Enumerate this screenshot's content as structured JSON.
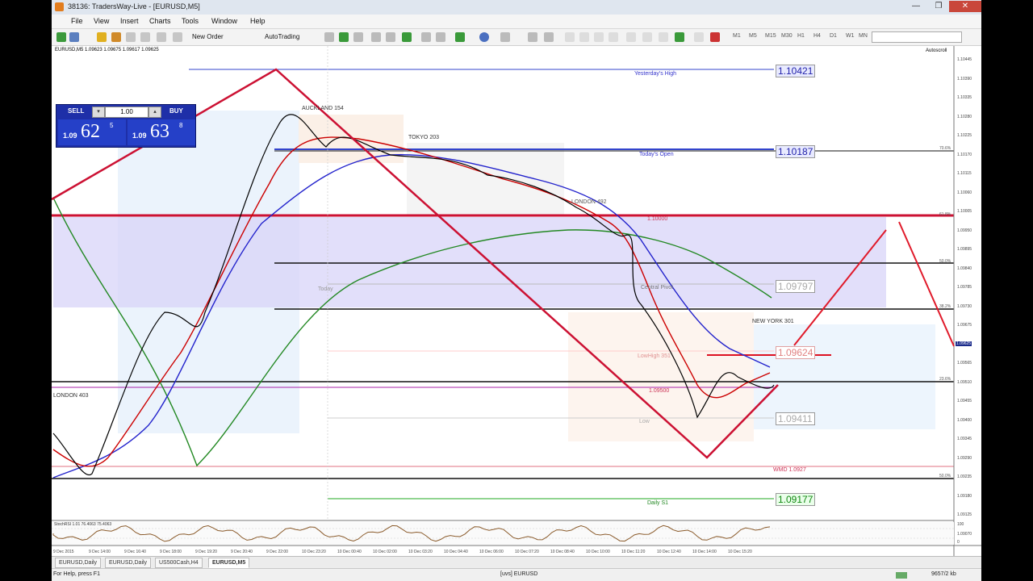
{
  "window": {
    "title": "38136: TradersWay-Live - [EURUSD,M5]",
    "minimize": "—",
    "restore": "❐",
    "close": "✕"
  },
  "menu": [
    "File",
    "View",
    "Insert",
    "Charts",
    "Tools",
    "Window",
    "Help"
  ],
  "toolbar": {
    "new_order": "New Order",
    "autotrading": "AutoTrading",
    "timeframes": [
      "M1",
      "M5",
      "M15",
      "M30",
      "H1",
      "H4",
      "D1",
      "W1",
      "MN"
    ]
  },
  "chart": {
    "header": "EURUSD,M5 1.09623 1.09675 1.09617 1.09625",
    "autoscroll_label": "Autoscroll",
    "oscillator_label": "StochRSI 1.01 76.4063 75.4063",
    "sessions": {
      "auckland": "AUCKLAND 154",
      "tokyo": "TOKYO 203",
      "london_top": "LONDON 492",
      "london_left": "LONDON 403",
      "new_york": "NEW YORK 301"
    },
    "levels": {
      "yesterdays_high": {
        "label": "Yesterday's High",
        "price": "1.10421"
      },
      "todays_open": {
        "label": "Today's Open",
        "price": "1.10187"
      },
      "central_pivot": {
        "label": "Central Pivot",
        "price": "1.09797"
      },
      "current": {
        "label": "",
        "price": "1.09624"
      },
      "low_label": {
        "label": "Low",
        "price": "1.09411"
      },
      "wmd": {
        "label": "WMD 1.0927"
      },
      "daily_s1": {
        "label": "Daily S1",
        "price": "1.09177"
      },
      "round_1": "1.10000",
      "round_2": "1.09500",
      "today_label": "Today",
      "lowhigh_label": "LowHigh 351"
    },
    "fib_labels": [
      "70.6%",
      "61.8%",
      "50.0%",
      "38.2%",
      "23.6%",
      "50.0%"
    ],
    "price_axis": [
      "1.10445",
      "1.10390",
      "1.10335",
      "1.10280",
      "1.10225",
      "1.10170",
      "1.10115",
      "1.10060",
      "1.10005",
      "1.09950",
      "1.09895",
      "1.09840",
      "1.09785",
      "1.09730",
      "1.09675",
      "1.09620",
      "1.09565",
      "1.09510",
      "1.09455",
      "1.09400",
      "1.09345",
      "1.09290",
      "1.09235",
      "1.09180",
      "1.09125",
      "1.09070"
    ],
    "current_price_tag": "1.09625",
    "time_axis": [
      "9 Dec 2015",
      "9 Dec 14:00",
      "9 Dec 16:40",
      "9 Dec 18:00",
      "9 Dec 19:20",
      "9 Dec 20:40",
      "9 Dec 22:00",
      "10 Dec 23:20",
      "10 Dec 00:40",
      "10 Dec 02:00",
      "10 Dec 03:20",
      "10 Dec 04:40",
      "10 Dec 06:00",
      "10 Dec 07:20",
      "10 Dec 08:40",
      "10 Dec 10:00",
      "10 Dec 11:20",
      "10 Dec 12:40",
      "10 Dec 14:00",
      "10 Dec 15:20"
    ],
    "osc_axis": [
      "100",
      "0"
    ]
  },
  "trade_panel": {
    "sell": "SELL",
    "buy": "BUY",
    "lot": "1.00",
    "sell_small": "1.09",
    "sell_big": "62",
    "sell_sup": "5",
    "buy_small": "1.09",
    "buy_big": "63",
    "buy_sup": "8"
  },
  "tabs": [
    "EURUSD,Daily",
    "EURUSD,Daily",
    "US500Cash,H4",
    "EURUSD,M5"
  ],
  "status": {
    "help": "For Help, press F1",
    "profile": "[uvs] EURUSD",
    "traffic": "9657/2 kb"
  },
  "colors": {
    "zigzag": "#cc1133",
    "ma_fast": "#000000",
    "ma_red": "#cc0000",
    "ma_blue": "#2222cc",
    "ma_green": "#228822",
    "zone": "#d8d4f8"
  }
}
